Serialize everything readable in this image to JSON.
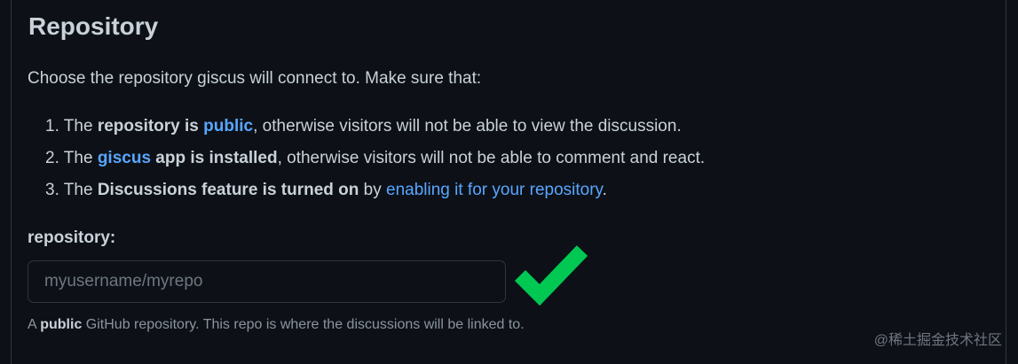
{
  "section": {
    "title": "Repository",
    "intro": "Choose the repository giscus will connect to. Make sure that:"
  },
  "requirements": [
    {
      "num": "1.",
      "pre": "The ",
      "bold1": "repository is ",
      "link": "public",
      "bold2": "",
      "post": ", otherwise visitors will not be able to view the discussion."
    },
    {
      "num": "2.",
      "pre": "The ",
      "link": "giscus",
      "bold2": " app is installed",
      "post": ", otherwise visitors will not be able to comment and react."
    },
    {
      "num": "3.",
      "pre": "The ",
      "bold1": "Discussions feature is turned on",
      "mid": " by ",
      "link": "enabling it for your repository",
      "post": "."
    }
  ],
  "field": {
    "label": "repository:",
    "value": "",
    "placeholder": "myusername/myrepo",
    "valid_color": "#00c853"
  },
  "hint": {
    "pre": "A ",
    "bold": "public",
    "post": " GitHub repository. This repo is where the discussions will be linked to."
  },
  "watermark": "@稀土掘金技术社区",
  "colors": {
    "background": "#0d1117",
    "text": "#c9d1d9",
    "link": "#58a6ff",
    "muted": "#8b949e",
    "border": "#30363d",
    "check": "#00c853"
  },
  "icons": {
    "validation": "checkmark-icon"
  }
}
